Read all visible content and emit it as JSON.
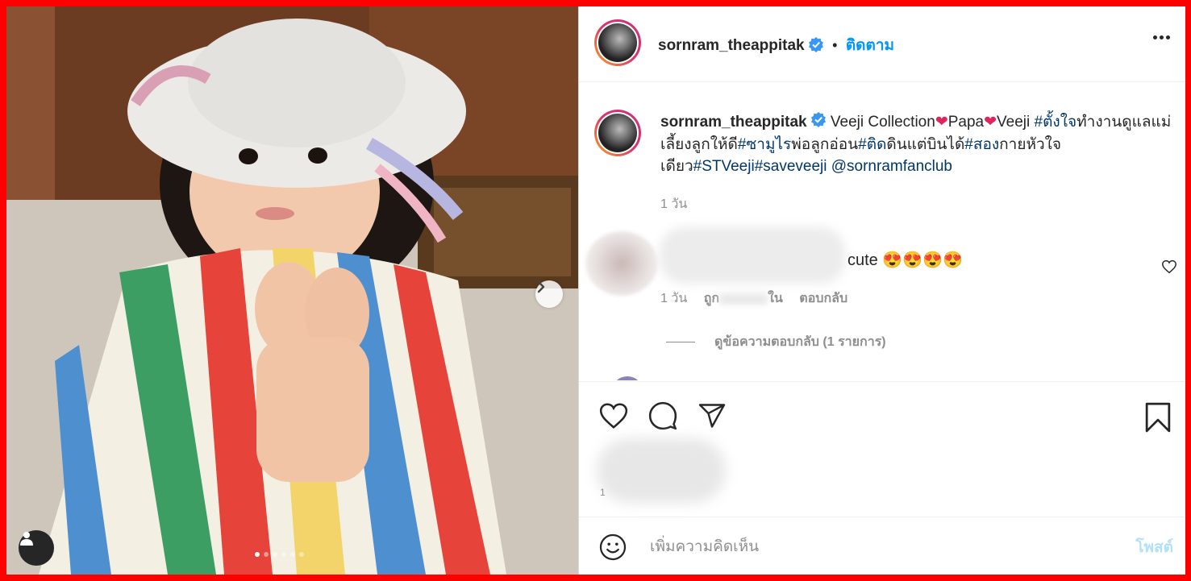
{
  "colors": {
    "accent": "#0095f6",
    "hashtag": "#00376b",
    "frame": "#ff0000",
    "muted": "#8e8e8e",
    "post_disabled": "#b2dffc"
  },
  "header": {
    "username": "sornram_theappitak",
    "separator": "•",
    "follow_label": "ติดตาม",
    "verified_icon": "verified-badge-icon",
    "more_icon": "more-horizontal-icon"
  },
  "caption": {
    "username": "sornram_theappitak",
    "text_1": "Veeji Collection",
    "text_2": "Papa",
    "text_3": "Veeji ",
    "tag_1": "#ตั้งใจ",
    "text_4": "ทำงานดูแลแม่เลี้ยงลูกให้ดี",
    "tag_2": "#ซามูไร",
    "text_5": "พ่อลูกอ่อน",
    "tag_3": "#ติด",
    "text_6": "ดินแต่บินได้",
    "tag_4": "#สอง",
    "text_7": "กายหัวใจเดียว",
    "tag_5": "#STVeeji",
    "tag_6": "#saveveeji",
    "mention": "@sornramfanclub",
    "time": "1 วัน"
  },
  "comment": {
    "text": "cute 😍😍😍😍",
    "time": "1 วัน",
    "likes_partial": "ถูก",
    "likes_partial_2": "ใน",
    "reply_label": "ตอบกลับ",
    "view_replies": "ดูข้อความตอบกลับ (1 รายการ)",
    "like_icon": "heart-outline-icon"
  },
  "actions": {
    "like_icon": "heart-icon",
    "comment_icon": "comment-icon",
    "share_icon": "paper-plane-icon",
    "save_icon": "bookmark-icon",
    "likes_partial": "1"
  },
  "composer": {
    "placeholder": "เพิ่มความคิดเห็น",
    "post_label": "โพสต์",
    "emoji_icon": "emoji-smile-icon"
  },
  "photo": {
    "next_icon": "chevron-right-icon",
    "user_tag_icon": "user-tag-icon",
    "carousel_count": 6,
    "carousel_active": 1
  }
}
